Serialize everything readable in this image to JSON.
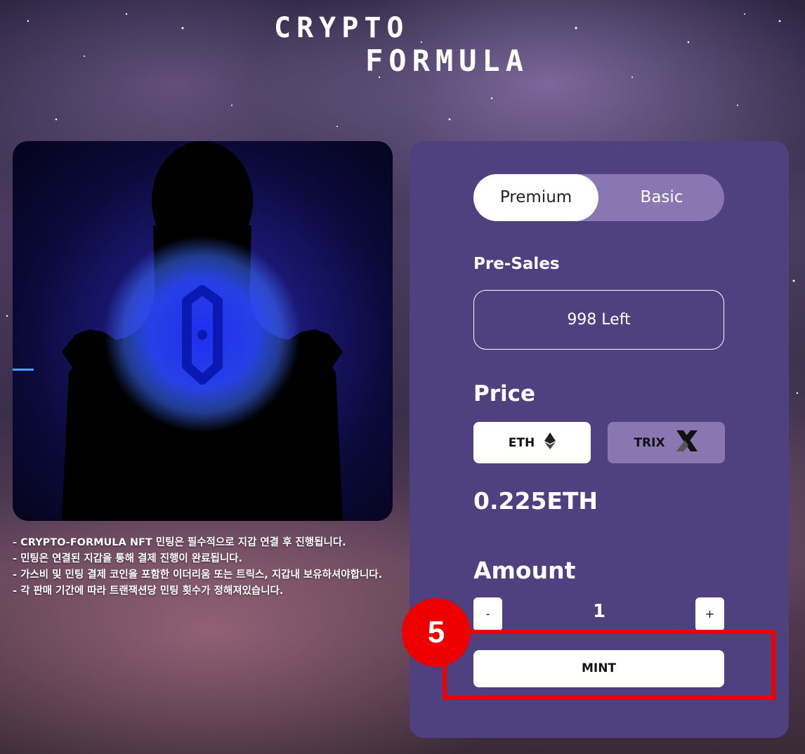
{
  "header": {
    "logo_line1": "CRYPTO",
    "logo_line2": "FORMULA"
  },
  "notes": [
    "- CRYPTO-FORMULA NFT 민팅은 필수적으로 지갑 연결 후 진행됩니다.",
    "- 민팅은 연결된 지갑을 통해 결제 진행이 완료됩니다.",
    "- 가스비 및 민팅 결제 코인을 포함한 이더리움 또는 트릭스, 지갑내 보유하셔야합니다.",
    "- 각 판매 기간에 따라 트랜잭션당 민팅 횟수가 정해져있습니다."
  ],
  "mint_panel": {
    "tier_toggle": {
      "premium": "Premium",
      "basic": "Basic",
      "selected": "Premium"
    },
    "presale_label": "Pre-Sales",
    "remaining": "998 Left",
    "price_label": "Price",
    "currency_eth": "ETH",
    "currency_trix": "TRIX",
    "selected_currency": "ETH",
    "price_value": "0.225ETH",
    "amount_label": "Amount",
    "decrement": "-",
    "increment": "+",
    "quantity": "1",
    "mint_button": "MINT"
  },
  "annotation": {
    "step_number": "5",
    "color": "#ee0000"
  },
  "icons": {
    "eth": "ethereum-icon",
    "trix": "trix-icon"
  },
  "colors": {
    "panel": "#4f4180",
    "toggle_inactive": "#8a76b0",
    "highlight": "#ee0000"
  }
}
